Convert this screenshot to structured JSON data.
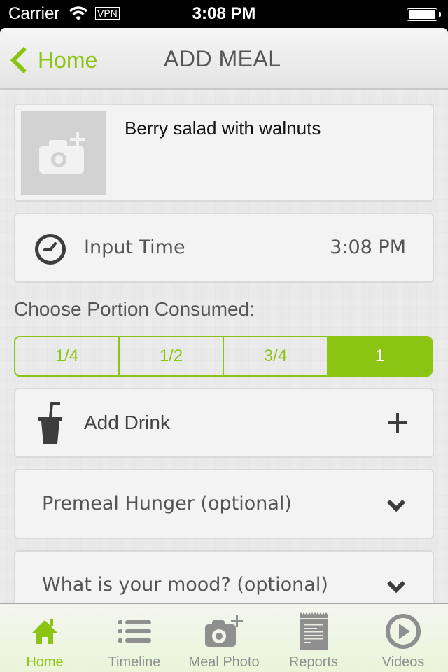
{
  "status_bar": {
    "carrier": "Carrier",
    "vpn": "VPN",
    "time": "3:08 PM",
    "battery_level": 1.0
  },
  "nav": {
    "back_label": "Home",
    "title": "ADD MEAL"
  },
  "meal": {
    "name": "Berry salad with walnuts",
    "photo_icon": "camera-add-icon"
  },
  "time_row": {
    "label": "Input Time",
    "value": "3:08 PM",
    "icon": "clock-icon"
  },
  "portion": {
    "label": "Choose Portion Consumed:",
    "options": [
      "1/4",
      "1/2",
      "3/4",
      "1"
    ],
    "selected": "1"
  },
  "drink_row": {
    "label": "Add Drink",
    "icon": "cup-icon",
    "action_icon": "plus-icon"
  },
  "dropdowns": [
    {
      "label": "Premeal Hunger (optional)",
      "icon": "chevron-down-icon"
    },
    {
      "label": "What is your mood? (optional)",
      "icon": "chevron-down-icon"
    }
  ],
  "tabs": [
    {
      "label": "Home",
      "icon": "home-icon",
      "active": true
    },
    {
      "label": "Timeline",
      "icon": "list-icon",
      "active": false
    },
    {
      "label": "Meal Photo",
      "icon": "camera-add-icon",
      "active": false
    },
    {
      "label": "Reports",
      "icon": "report-icon",
      "active": false
    },
    {
      "label": "Videos",
      "icon": "play-circle-icon",
      "active": false
    }
  ],
  "colors": {
    "accent": "#8cc414",
    "text_dark": "#444444",
    "tab_inactive": "#8f8f8f"
  }
}
